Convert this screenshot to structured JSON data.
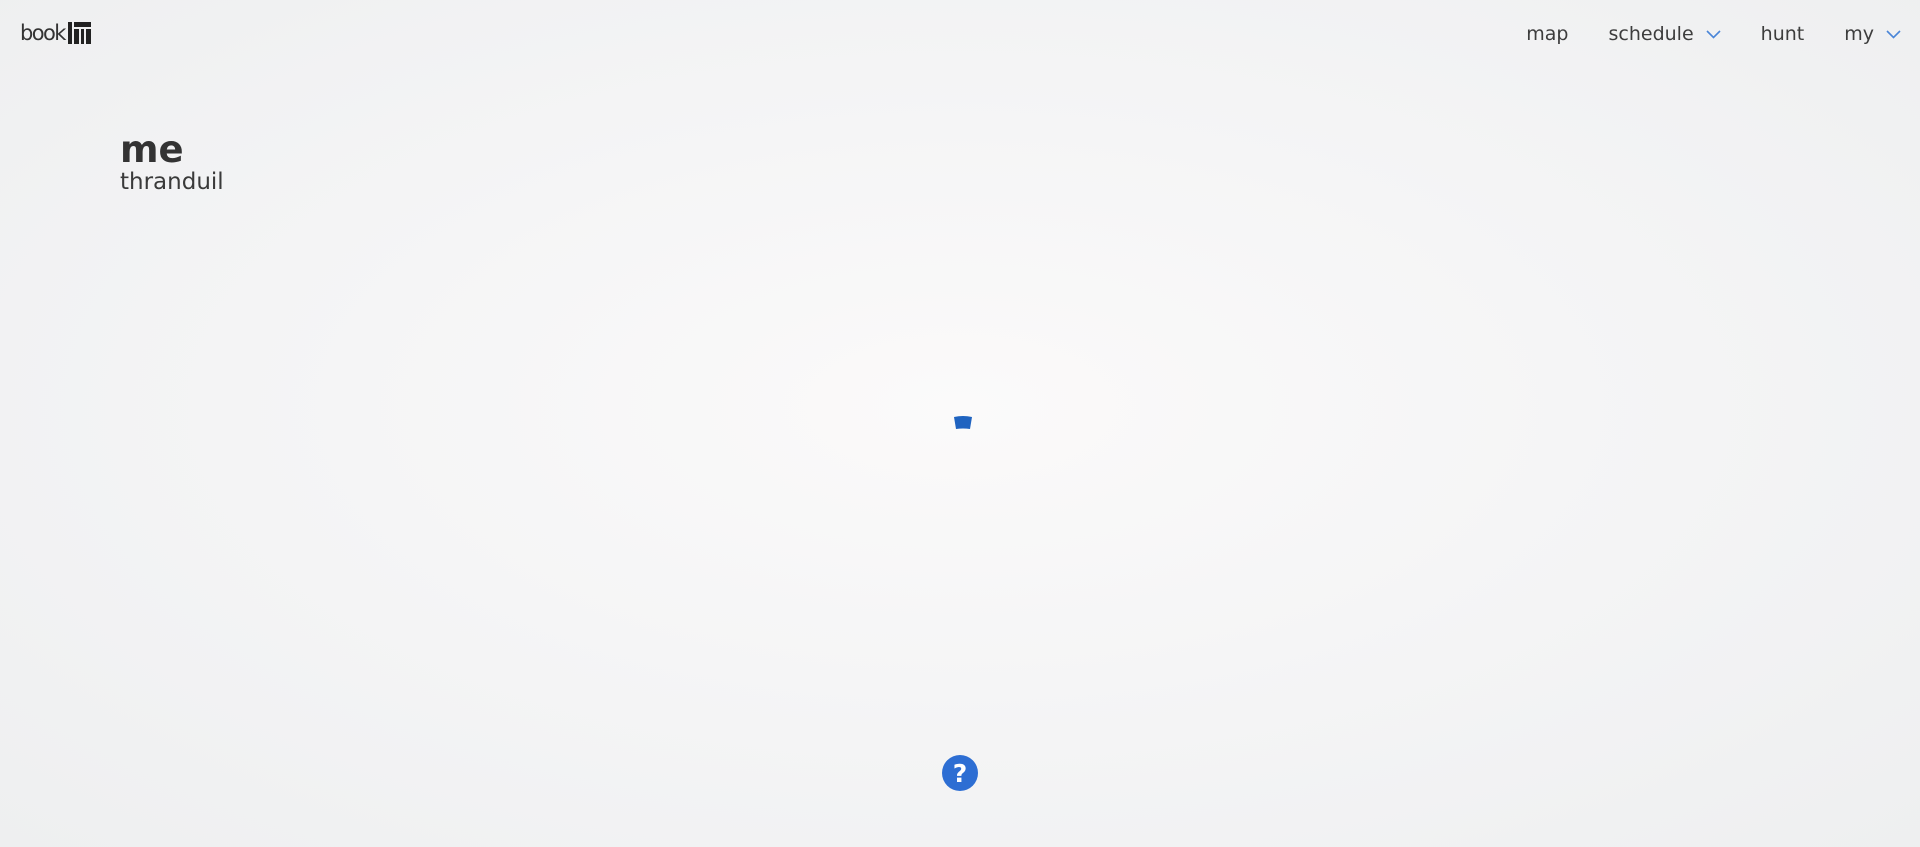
{
  "header": {
    "logo": {
      "text": "book",
      "icon": "book-mark-icon"
    },
    "nav": [
      {
        "label": "map",
        "has_dropdown": false
      },
      {
        "label": "schedule",
        "has_dropdown": true
      },
      {
        "label": "hunt",
        "has_dropdown": false
      },
      {
        "label": "my",
        "has_dropdown": true
      }
    ],
    "dropdown_icon": "chevron-down-icon",
    "chevron_color": "#4a86d8"
  },
  "page": {
    "title": "me",
    "subtitle": "thranduil"
  },
  "loader": {
    "icon": "loading-spinner-icon",
    "color": "#1f63c0"
  },
  "help": {
    "icon": "help-icon",
    "glyph": "?",
    "color": "#2d6ed3"
  }
}
